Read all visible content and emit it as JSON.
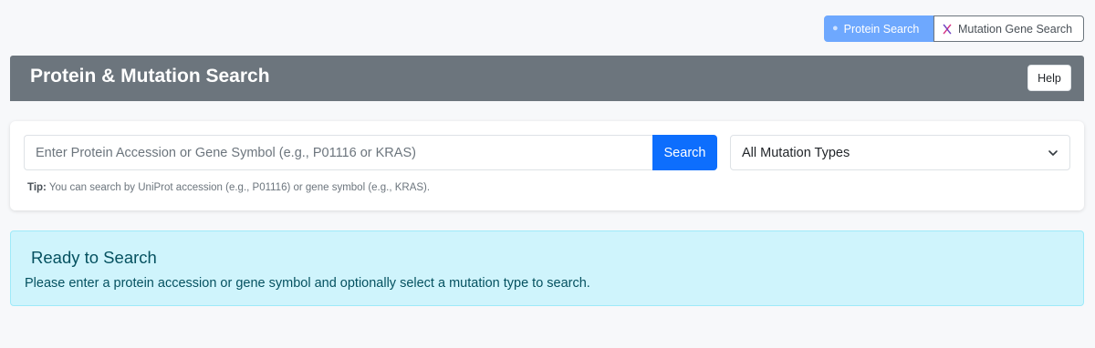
{
  "mode_toggle": {
    "protein_label": "Protein Search",
    "protein_icon": "circle-dot-icon",
    "mutation_label": "Mutation Gene Search",
    "mutation_icon": "dna-icon",
    "active": "protein"
  },
  "header": {
    "title": "Protein & Mutation Search",
    "help_label": "Help"
  },
  "search": {
    "placeholder": "Enter Protein Accession or Gene Symbol (e.g., P01116 or KRAS)",
    "value": "",
    "button_label": "Search",
    "mutation_type_selected": "All Mutation Types",
    "tip_label": "Tip:",
    "tip_text": " You can search by UniProt accession (e.g., P01116) or gene symbol (e.g., KRAS)."
  },
  "status": {
    "title": "Ready to Search",
    "message": "Please enter a protein accession or gene symbol and optionally select a mutation type to search."
  },
  "colors": {
    "header_bg": "#6c757d",
    "primary": "#0d6efd",
    "active_toggle": "#6ea8fe",
    "alert_bg": "#cff4fc",
    "alert_text": "#055160"
  }
}
